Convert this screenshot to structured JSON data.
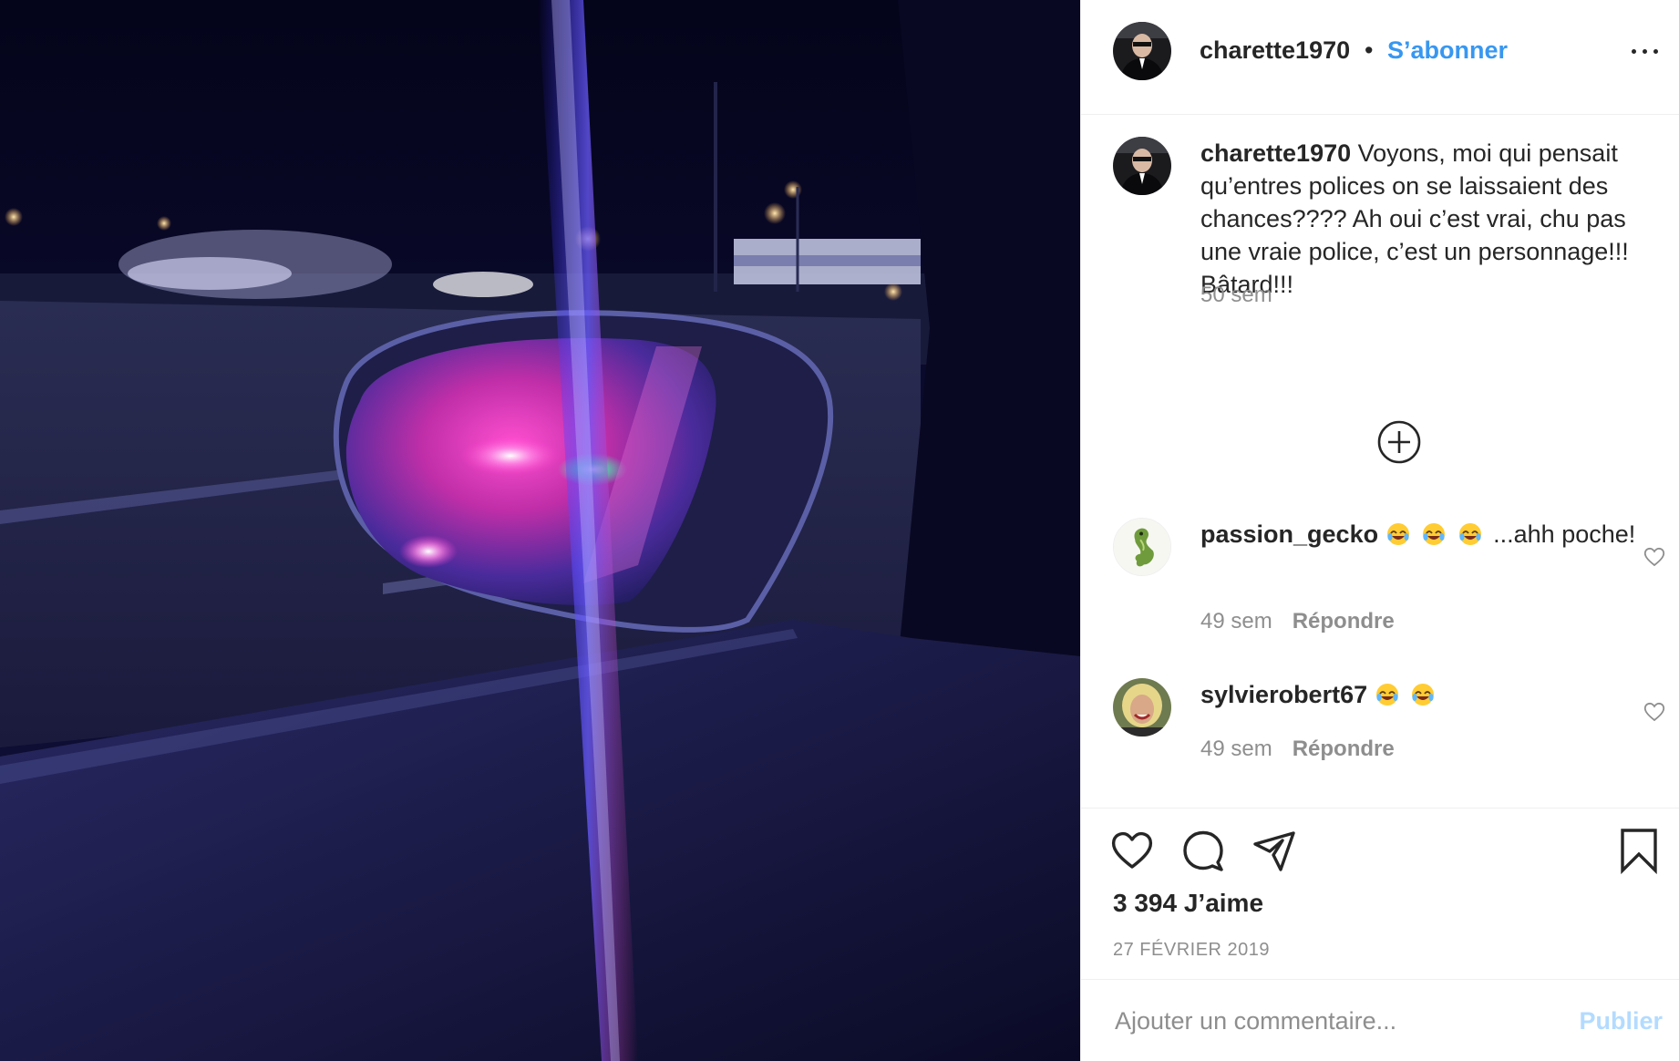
{
  "header": {
    "username": "charette1970",
    "separator": "•",
    "follow_label": "S’abonner"
  },
  "caption": {
    "username": "charette1970",
    "text": "Voyons, moi qui pensait qu’entres polices on se laissaient des chances???? Ah oui c’est vrai, chu pas une vraie police, c’est un personnage!!! Bâtard!!!",
    "time": "50 sem"
  },
  "comments": [
    {
      "username": "passion_gecko",
      "emojis": [
        "face-with-tears-of-joy",
        "face-with-tears-of-joy",
        "face-with-tears-of-joy"
      ],
      "text": "...ahh poche!",
      "time": "49 sem",
      "reply_label": "Répondre"
    },
    {
      "username": "sylvierobert67",
      "emojis": [
        "face-with-tears-of-joy",
        "face-with-tears-of-joy"
      ],
      "text": "",
      "time": "49 sem",
      "reply_label": "Répondre"
    }
  ],
  "actions": {
    "icons": [
      "heart-icon",
      "comment-icon",
      "share-icon",
      "bookmark-icon"
    ],
    "likes": "3 394 J’aime",
    "date": "27 FÉVRIER 2019"
  },
  "add_comment": {
    "placeholder": "Ajouter un commentaire...",
    "publish_label": "Publier"
  },
  "colors": {
    "link_blue": "#3897f0",
    "publish_disabled": "#b3dbff",
    "secondary_text": "#8e8e8e"
  }
}
